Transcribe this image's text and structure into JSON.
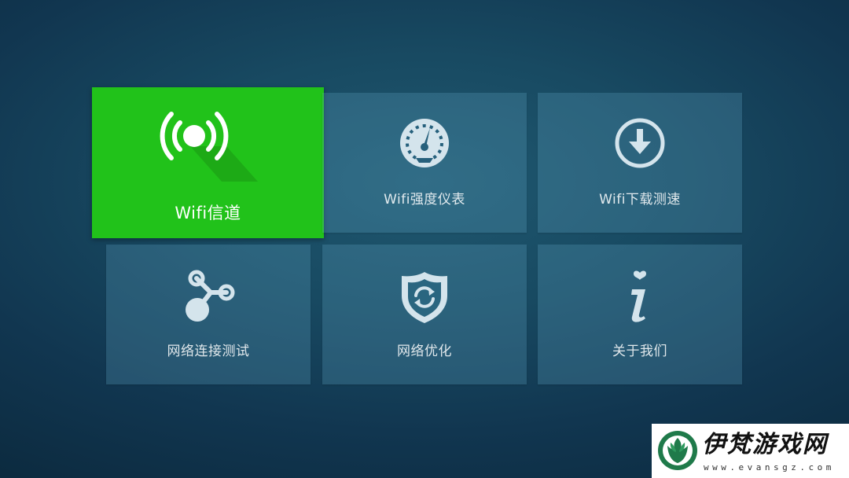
{
  "menu": {
    "items": [
      {
        "label": "Wifi信道",
        "icon": "wifi-signal-icon",
        "selected": true
      },
      {
        "label": "Wifi强度仪表",
        "icon": "gauge-icon",
        "selected": false
      },
      {
        "label": "Wifi下载测速",
        "icon": "download-icon",
        "selected": false
      },
      {
        "label": "网络连接测试",
        "icon": "connection-nodes-icon",
        "selected": false
      },
      {
        "label": "网络优化",
        "icon": "shield-refresh-icon",
        "selected": false
      },
      {
        "label": "关于我们",
        "icon": "info-heart-icon",
        "selected": false
      }
    ]
  },
  "colors": {
    "selected_tile": "#21c21a",
    "tile": "rgba(100,170,200,0.26)",
    "background": "#184a62",
    "icon": "#d4e4ec"
  },
  "watermark": {
    "title": "伊梵游戏网",
    "url": "www.evansgz.com"
  }
}
